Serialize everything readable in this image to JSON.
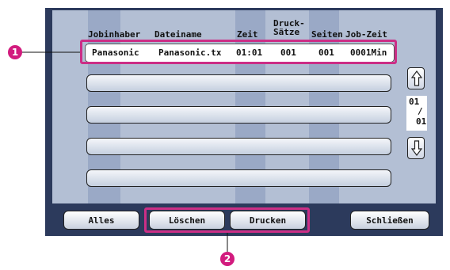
{
  "table": {
    "headers": {
      "owner": "Jobinhaber",
      "filename": "Dateiname",
      "time": "Zeit",
      "records_line1": "Druck-",
      "records_line2": "Sätze",
      "pages": "Seiten",
      "jobtime": "Job-Zeit"
    },
    "rows": [
      {
        "owner": "Panasonic",
        "filename": "Panasonic.tx",
        "time": "01:01",
        "records": "001",
        "pages": "001",
        "jobtime": "0001Min"
      }
    ]
  },
  "pager": {
    "current": "01",
    "separator": "/",
    "total": "01"
  },
  "buttons": {
    "all": "Alles",
    "delete": "Löschen",
    "print": "Drucken",
    "close": "Schließen"
  },
  "callouts": {
    "one": "1",
    "two": "2"
  },
  "colors": {
    "highlight": "#cc2e86",
    "callout": "#d21b7e",
    "frame": "#2c3a5c",
    "panel": "#b3bfd4"
  }
}
